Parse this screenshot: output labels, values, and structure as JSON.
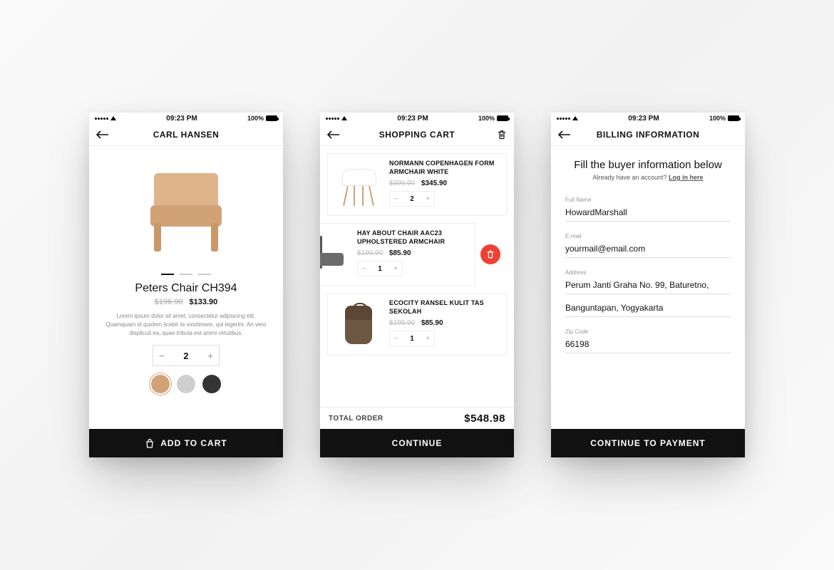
{
  "statusbar": {
    "time": "09:23 PM",
    "battery_label": "100%"
  },
  "screen1": {
    "title": "CARL HANSEN",
    "product_name": "Peters Chair CH394",
    "price_old": "$196.90",
    "price_new": "$133.90",
    "description": "Lorem ipsum dolor sit amet, consectetur adipiscing elit. Quamquam id quidem licebit iis existimare, qui legerint. An vero displicuit ea, quae tributa est animi virtutibus.",
    "quantity": "2",
    "swatches": [
      "#d2a277",
      "#cfcfcf",
      "#343434"
    ],
    "cta": "ADD TO CART"
  },
  "screen2": {
    "title": "SHOPPING CART",
    "items": [
      {
        "name": "NORMANN COPENHAGEN FORM ARMCHAIR WHITE",
        "price_old": "$399.90",
        "price_new": "$345.90",
        "qty": "2"
      },
      {
        "name": "HAY ABOUT CHAIR AAC23 UPHOLSTERED ARMCHAIR",
        "price_old": "$199.90",
        "price_new": "$85.90",
        "qty": "1"
      },
      {
        "name": "ECOCITY RANSEL KULIT TAS SEKOLAH",
        "price_old": "$199.90",
        "price_new": "$85.90",
        "qty": "1"
      }
    ],
    "total_label": "TOTAL ORDER",
    "total_amount": "$548.98",
    "cta": "CONTINUE"
  },
  "screen3": {
    "title": "BILLING INFORMATION",
    "heading": "Fill the buyer information below",
    "sub_prefix": "Already have an account? ",
    "login_link": "Log in here",
    "fields": {
      "fullname_label": "Full Name",
      "fullname_value": "HowardMarshall",
      "email_label": "E-mail",
      "email_value": "yourmail@email.com",
      "address_label": "Address",
      "address_line1": "Perum Janti Graha No. 99, Baturetno,",
      "address_line2": "Banguntapan, Yogyakarta",
      "zip_label": "Zip Code",
      "zip_value": "66198"
    },
    "cta": "CONTINUE TO PAYMENT"
  }
}
